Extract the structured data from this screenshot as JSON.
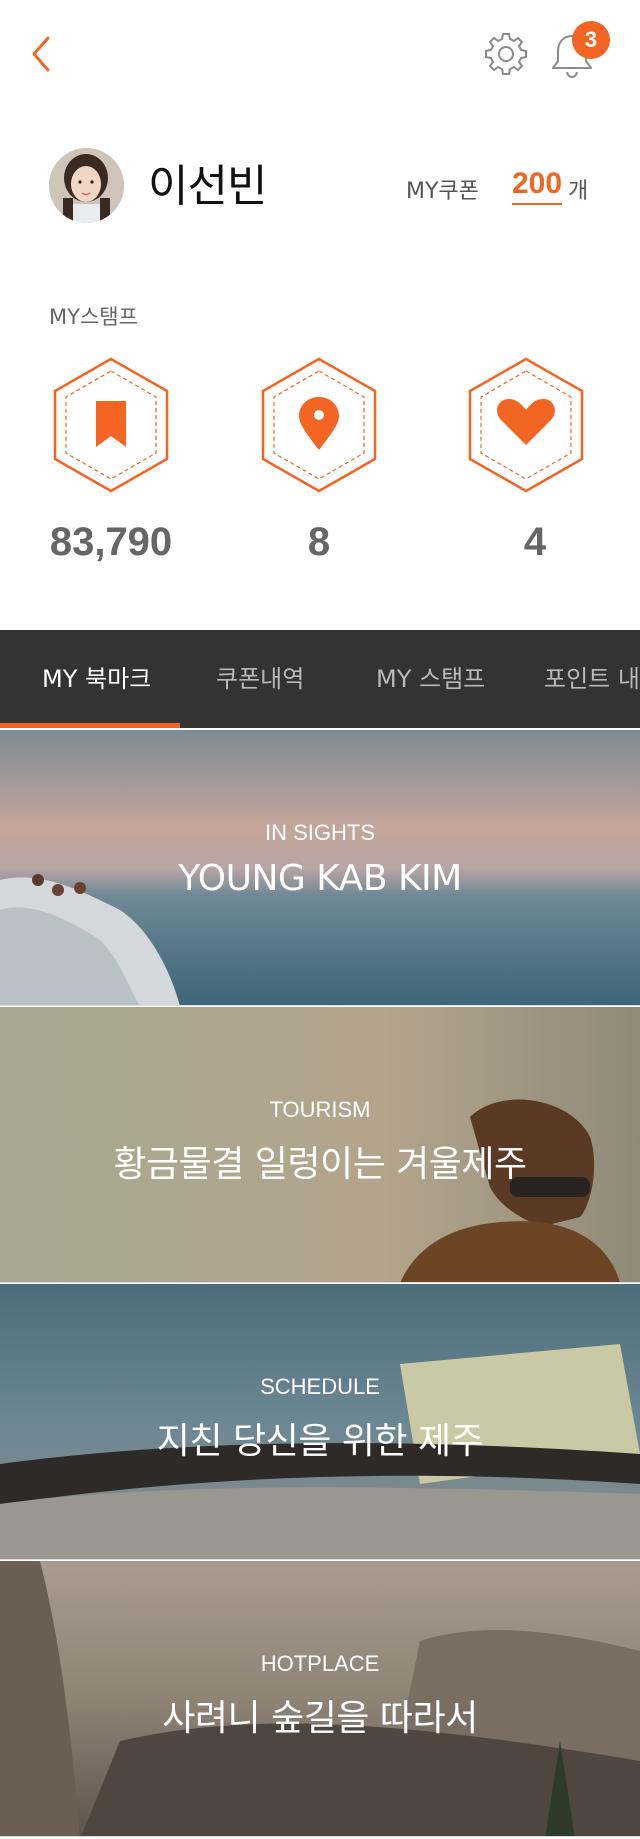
{
  "header": {
    "notification_count": "3",
    "accent_color": "#f26522"
  },
  "profile": {
    "name": "이선빈",
    "coupon_label": "MY쿠폰",
    "coupon_count": "200",
    "coupon_unit": "개"
  },
  "stamps": {
    "title": "MY스탬프",
    "items": [
      {
        "icon": "bookmark-icon",
        "value": "83,790"
      },
      {
        "icon": "location-pin-icon",
        "value": "8"
      },
      {
        "icon": "heart-icon",
        "value": "4"
      }
    ]
  },
  "tabs": [
    {
      "label": "MY 북마크",
      "active": true
    },
    {
      "label": "쿠폰내역",
      "active": false
    },
    {
      "label": "MY 스탬프",
      "active": false
    },
    {
      "label": "포인트 내역",
      "active": false
    }
  ],
  "bookmarks": [
    {
      "category": "IN SIGHTS",
      "title": "YOUNG KAB KIM"
    },
    {
      "category": "TOURISM",
      "title": "황금물결 일렁이는 겨울제주"
    },
    {
      "category": "SCHEDULE",
      "title": "지친 당신을 위한 제주"
    },
    {
      "category": "HOTPLACE",
      "title": "사려니 숲길을 따라서"
    }
  ]
}
